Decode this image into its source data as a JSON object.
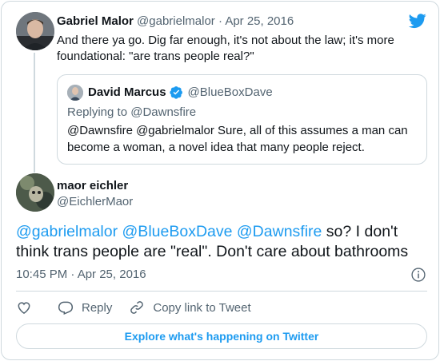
{
  "parent_tweet": {
    "author_name": "Gabriel Malor",
    "author_handle": "@gabrielmalor",
    "separator": "·",
    "date": "Apr 25, 2016",
    "text": "And there ya go. Dig far enough, it's not about the law; it's more foundational: \"are trans people real?\"",
    "quoted": {
      "author_name": "David Marcus",
      "author_handle": "@BlueBoxDave",
      "replying_to": "Replying to @Dawnsfire",
      "text": "@Dawnsfire @gabrielmalor Sure, all of this assumes a man can become a woman, a novel idea that many people reject."
    }
  },
  "main_tweet": {
    "author_name": "maor eichler",
    "author_handle": "@EichlerMaor",
    "mentions": [
      "@gabrielmalor",
      "@BlueBoxDave",
      "@Dawnsfire"
    ],
    "text_after_mentions": " so? I don't think trans people are \"real\". Don't care about bathrooms",
    "timestamp": "10:45 PM · Apr 25, 2016"
  },
  "actions": {
    "like_icon": "heart-icon",
    "reply_label": "Reply",
    "copy_link_label": "Copy link to Tweet"
  },
  "explore_label": "Explore what's happening on Twitter",
  "icons": {
    "brand": "twitter-bird-icon",
    "verified": "verified-badge-icon",
    "info": "info-icon"
  },
  "colors": {
    "accent": "#1d9bf0",
    "text": "#0f1419",
    "muted": "#536471",
    "border": "#cfd9de"
  }
}
